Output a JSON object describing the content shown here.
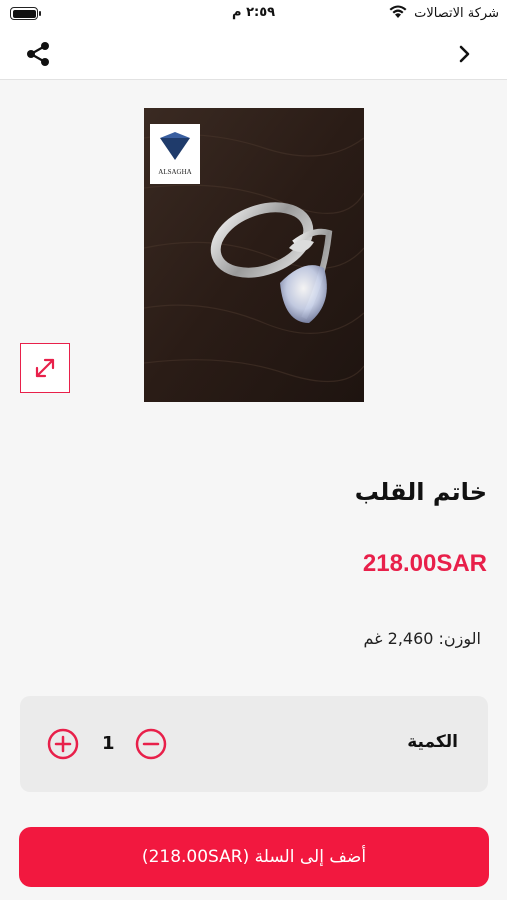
{
  "status_bar": {
    "carrier": "شركة الاتصالات",
    "time": "٢:٥٩ م"
  },
  "navbar": {
    "share_icon": "share-icon",
    "back_icon": "chevron-right-icon"
  },
  "product": {
    "brand_logo_text": "ALSAGHA",
    "title": "خاتم القلب",
    "price": "218.00SAR",
    "weight": "الوزن: 2,460 غم"
  },
  "quantity": {
    "label": "الكمية",
    "value": "1"
  },
  "cart_button": {
    "label": "أضف إلى السلة (218.00SAR)"
  },
  "colors": {
    "accent": "#e8204a",
    "button": "#f2183f"
  }
}
